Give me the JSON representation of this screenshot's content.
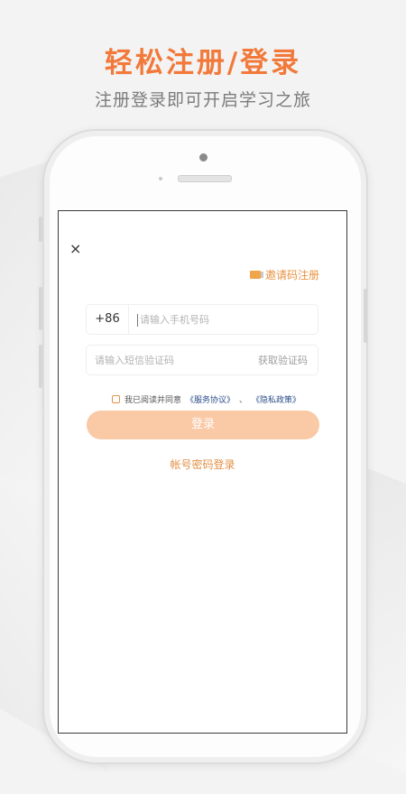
{
  "promo": {
    "headline": "轻松注册/登录",
    "subline": "注册登录即可开启学习之旅"
  },
  "screen": {
    "close_glyph": "×",
    "invite_label": "邀请码注册",
    "phone": {
      "country_code": "+86",
      "placeholder": "请输入手机号码"
    },
    "sms": {
      "placeholder": "请输入短信验证码",
      "get_code_label": "获取验证码"
    },
    "agreement": {
      "prefix": "我已阅读并同意",
      "service_link": "《服务协议》",
      "separator": "、",
      "privacy_link": "《隐私政策》"
    },
    "login_label": "登录",
    "password_login_label": "帐号密码登录"
  },
  "colors": {
    "accent": "#f2793a",
    "button_disabled": "#fac9a6",
    "link": "#2b4d88"
  }
}
